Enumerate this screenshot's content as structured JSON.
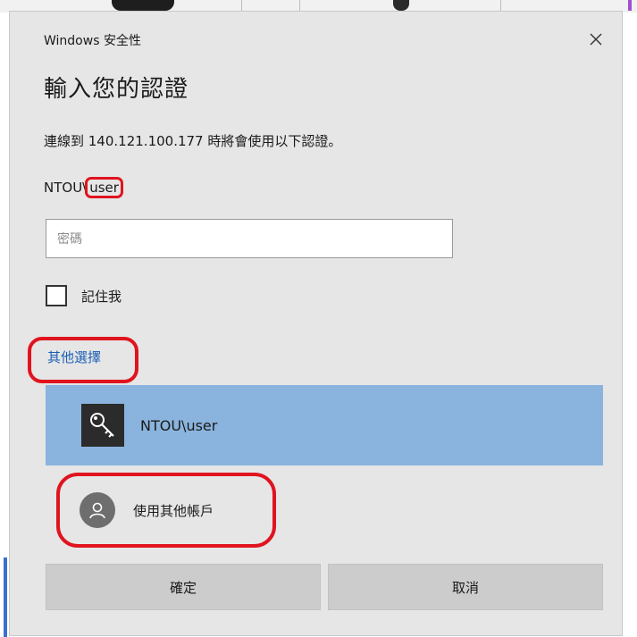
{
  "dialog": {
    "title": "Windows 安全性",
    "heading": "輸入您的認證",
    "info": "連線到 140.121.100.177 時將會使用以下認證。",
    "user_domain": "NTOU\\",
    "user_name": "user",
    "password_placeholder": "密碼",
    "remember_label": "記住我",
    "remember_checked": false,
    "other_options_label": "其他選擇",
    "selected_account": "NTOU\\user",
    "other_account_label": "使用其他帳戶",
    "ok_label": "確定",
    "cancel_label": "取消"
  },
  "icons": {
    "close": "close-icon",
    "key": "key-icon",
    "person": "person-icon"
  },
  "colors": {
    "highlight_red": "#e0141e",
    "selected_bg": "#8ab4dd",
    "link_blue": "#1a5fb4",
    "dialog_bg": "#e6e6e6"
  }
}
